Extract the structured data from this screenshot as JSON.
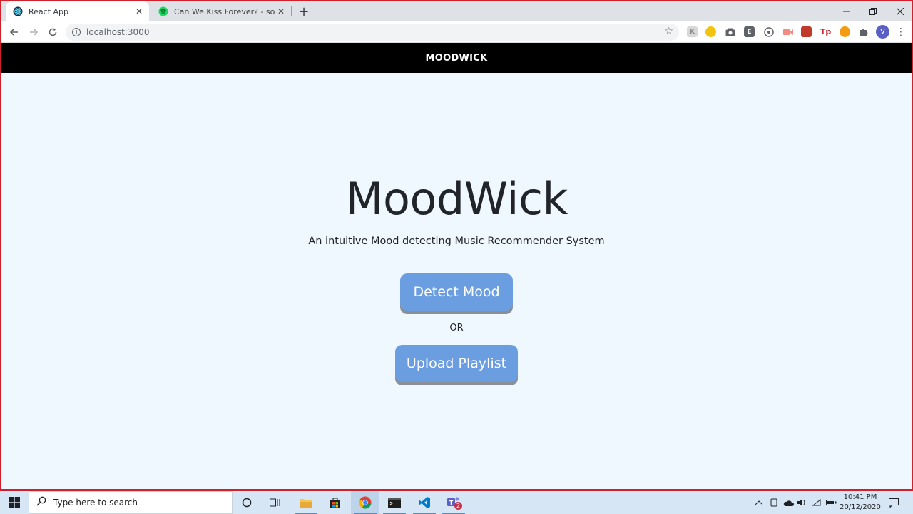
{
  "browser": {
    "tabs": [
      {
        "title": "React App",
        "icon": "react-icon",
        "active": true
      },
      {
        "title": "Can We Kiss Forever? - song by K",
        "icon": "spotify-icon",
        "active": false
      }
    ],
    "new_tab": "+",
    "address": "localhost:3000",
    "profile_initial": "V",
    "extensions": [
      "K",
      "",
      "",
      "E",
      "",
      "",
      "",
      "Tp",
      "",
      ""
    ]
  },
  "app": {
    "navbar_title": "MOODWICK",
    "hero_title": "MoodWick",
    "hero_subtitle": "An intuitive Mood detecting Music Recommender System",
    "detect_button": "Detect Mood",
    "or_text": "OR",
    "upload_button": "Upload Playlist"
  },
  "taskbar": {
    "search_placeholder": "Type here to search",
    "time": "10:41 PM",
    "date": "20/12/2020",
    "teams_badge": "2"
  },
  "colors": {
    "page_bg": "#f0f8ff",
    "navbar_bg": "#000000",
    "button_bg": "#6a9ee0",
    "window_border": "#d0202c"
  }
}
